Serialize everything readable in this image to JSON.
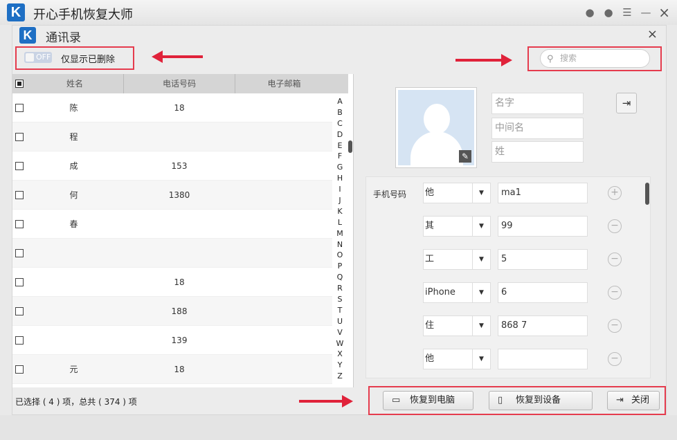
{
  "app": {
    "title": "开心手机恢复大师",
    "logo": "K"
  },
  "dialog": {
    "title": "通讯录",
    "logo": "K",
    "close": "×"
  },
  "filter": {
    "toggle_state": "OFF",
    "label": "仅显示已删除"
  },
  "search": {
    "placeholder": "搜索"
  },
  "table": {
    "headers": {
      "name": "姓名",
      "phone": "电话号码",
      "email": "电子邮箱"
    },
    "rows": [
      {
        "name": "陈",
        "phone": "18"
      },
      {
        "name": "程",
        "phone": ""
      },
      {
        "name": "成",
        "phone": "153"
      },
      {
        "name": "何",
        "phone": "1380"
      },
      {
        "name": "春",
        "phone": ""
      },
      {
        "name": "",
        "phone": ""
      },
      {
        "name": "",
        "phone": "18"
      },
      {
        "name": "",
        "phone": "188"
      },
      {
        "name": "",
        "phone": "139"
      },
      {
        "name": "元",
        "phone": "18"
      }
    ],
    "alphabet": [
      "A",
      "B",
      "C",
      "D",
      "E",
      "F",
      "G",
      "H",
      "I",
      "J",
      "K",
      "L",
      "M",
      "N",
      "O",
      "P",
      "Q",
      "R",
      "S",
      "T",
      "U",
      "V",
      "W",
      "X",
      "Y",
      "Z"
    ]
  },
  "contact": {
    "first_name_placeholder": "名字",
    "middle_name_placeholder": "中间名",
    "last_name_placeholder": "姓",
    "phone_label": "手机号码",
    "phones": [
      {
        "type": "他",
        "value": "ma1",
        "action": "+"
      },
      {
        "type": "其",
        "value": "99",
        "action": "−"
      },
      {
        "type": "工",
        "value": "5",
        "action": "−"
      },
      {
        "type": "iPhone",
        "value": "6",
        "action": "−"
      },
      {
        "type": "住",
        "value": "868 7",
        "action": "−"
      },
      {
        "type": "他",
        "value": "",
        "action": "−"
      }
    ]
  },
  "footer": {
    "status": "已选择 ( 4 ) 项，总共 ( 374 ) 项",
    "restore_pc": "恢复到电脑",
    "restore_device": "恢复到设备",
    "close": "关闭"
  }
}
